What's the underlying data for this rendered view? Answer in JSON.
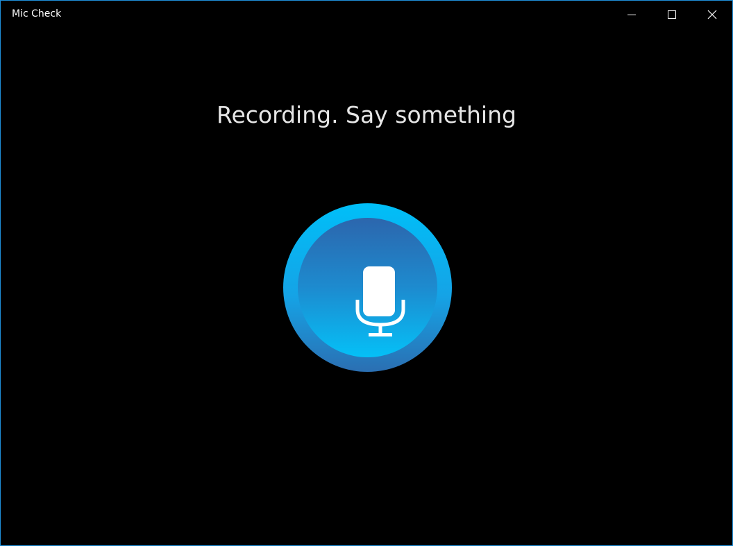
{
  "window": {
    "title": "Mic Check",
    "border_color": "#1f8fd9",
    "background": "#000000"
  },
  "caption_buttons": {
    "minimize_icon": "minimize-icon",
    "maximize_icon": "maximize-icon",
    "close_icon": "close-icon"
  },
  "main": {
    "status_text": "Recording. Say something",
    "mic_button": {
      "icon": "microphone-icon",
      "outer_gradient": [
        "#00bff8",
        "#2b6fb2"
      ],
      "inner_gradient": [
        "#2c66ad",
        "#05c0f7"
      ]
    }
  }
}
